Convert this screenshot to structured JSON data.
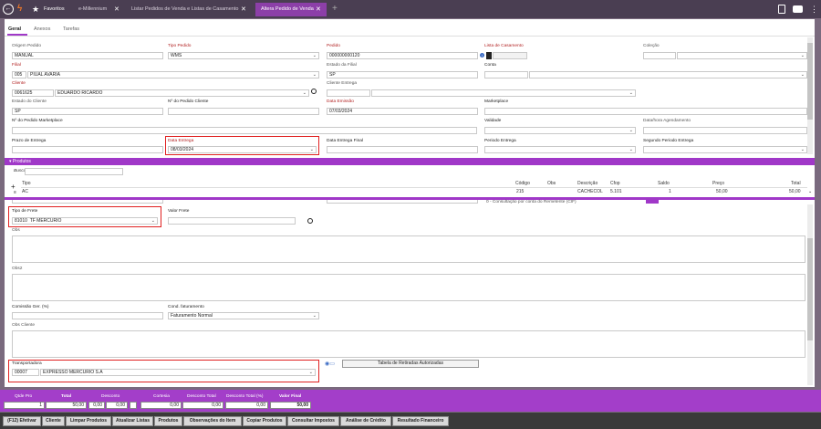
{
  "topbar": {
    "favorites_label": "Favoritos",
    "tabs": [
      {
        "label": "e-Millennium"
      },
      {
        "label": "Listar Pedidos de Venda e Listas de Casamento"
      },
      {
        "label": "Altera Pedido de Venda"
      }
    ],
    "close_glyph": "✕",
    "add_glyph": "+"
  },
  "subtabs": [
    {
      "label": "Geral"
    },
    {
      "label": "Anexos"
    },
    {
      "label": "Tarefas"
    }
  ],
  "form": {
    "origem_label": "Origem Pedido",
    "origem_value": "MANUAL",
    "tipo_label": "Tipo Pedido",
    "tipo_value": "WMS",
    "pedido_label": "Pedido",
    "pedido_value": "000000000120",
    "lista_label": "Lista de Casamento",
    "colecao_label": "Coleção",
    "filial_label": "Filial",
    "filial_code": "005",
    "filial_name": "PIUAL AVARIA",
    "estado_filial_label": "Estado da Filial",
    "estado_filial_value": "SP",
    "conta_label": "Conta",
    "cliente_label": "Cliente",
    "cliente_code": "0061625",
    "cliente_name": "EDUARDO RICARDO",
    "cliente_entrega_label": "Cliente Entrega",
    "estado_cliente_label": "Estado do Cliente",
    "estado_cliente_value": "SP",
    "n_pedido_cliente_label": "Nº do Pedido Cliente",
    "data_emissao_label": "Data Emissão",
    "data_emissao_value": "07/03/2024",
    "marketplace_label": "Marketplace",
    "n_pedido_marketplace_label": "Nº do Pedido Marketplace",
    "validade_label": "Validade",
    "data_agendamento_label": "Data/hora Agendamento",
    "prazo_label": "Prazo de Entrega",
    "data_entrega_label": "Data Entrega",
    "data_entrega_value": "08/03/2024",
    "data_entrega_final_label": "Data Entrega Final",
    "periodo_label": "Periodo Entrega",
    "segundo_periodo_label": "Segundo Periodo Entrega"
  },
  "produtos": {
    "header": "Produtos",
    "search_label": "Buscar",
    "columns": {
      "tipo": "Tipo",
      "codigo": "Código",
      "obs": "Obs",
      "descricao": "Descrição",
      "cfop": "Cfop",
      "saldo": "Saldo",
      "preco": "Preço",
      "total": "Total"
    },
    "row": {
      "tipo": "AC",
      "codigo": "215",
      "descricao": "CACHECOL",
      "cfop": "5.101",
      "saldo": "1",
      "preco": "50,00",
      "total": "50,00"
    },
    "plus": "+",
    "cut_text": "0 - Consultação por conta do Remetente (CIF)"
  },
  "frete": {
    "tipo_frete_label": "Tipo de Frete",
    "tipo_frete_code": "81010",
    "tipo_frete_name": "TF MERCURIO",
    "valor_frete_label": "Valor Frete",
    "obs_label": "Obs",
    "obs2_label": "Obs2",
    "comissao_label": "Comissão Ger. (%)",
    "cond_label": "Cond. faturamento",
    "cond_value": "Faturamento Normal",
    "obs_cliente_label": "Obs Cliente",
    "transportadora_label": "Transportadora",
    "transportadora_code": "00007",
    "transportadora_name": "EXPRESSO MERCURIO S.A",
    "tabela_button": "Tabela de Retiradas Autorizadas"
  },
  "footer": {
    "qtde_label": "Qtde Pro",
    "qtde_value": "1",
    "total_label": "Total",
    "total_value": "50,00",
    "desconto_label": "Desconto",
    "desconto_pct": "0,00",
    "desconto_value": "0,00",
    "cortesia_label": "Cortesia",
    "cortesia_value": "0,00",
    "desc_total_label": "Desconto Total",
    "desc_total_value": "0,00",
    "desc_total_pct_label": "Desconto Total (%)",
    "desc_total_pct_value": "0,00",
    "valor_final_label": "Valor Final",
    "valor_final_value": "50,00"
  },
  "buttons": [
    "(F12) Efetivar",
    "Cliente",
    "Limpar Produtos",
    "Atualizar Listas",
    "Produtos",
    "Observações do Item",
    "Copiar Produtos",
    "Consultar Impostos",
    "Análise de Crédito",
    "Resultado Financeiro"
  ],
  "colors": {
    "accent": "#a038c8",
    "topbar": "#4a3e52",
    "highlight": "#e02020"
  }
}
